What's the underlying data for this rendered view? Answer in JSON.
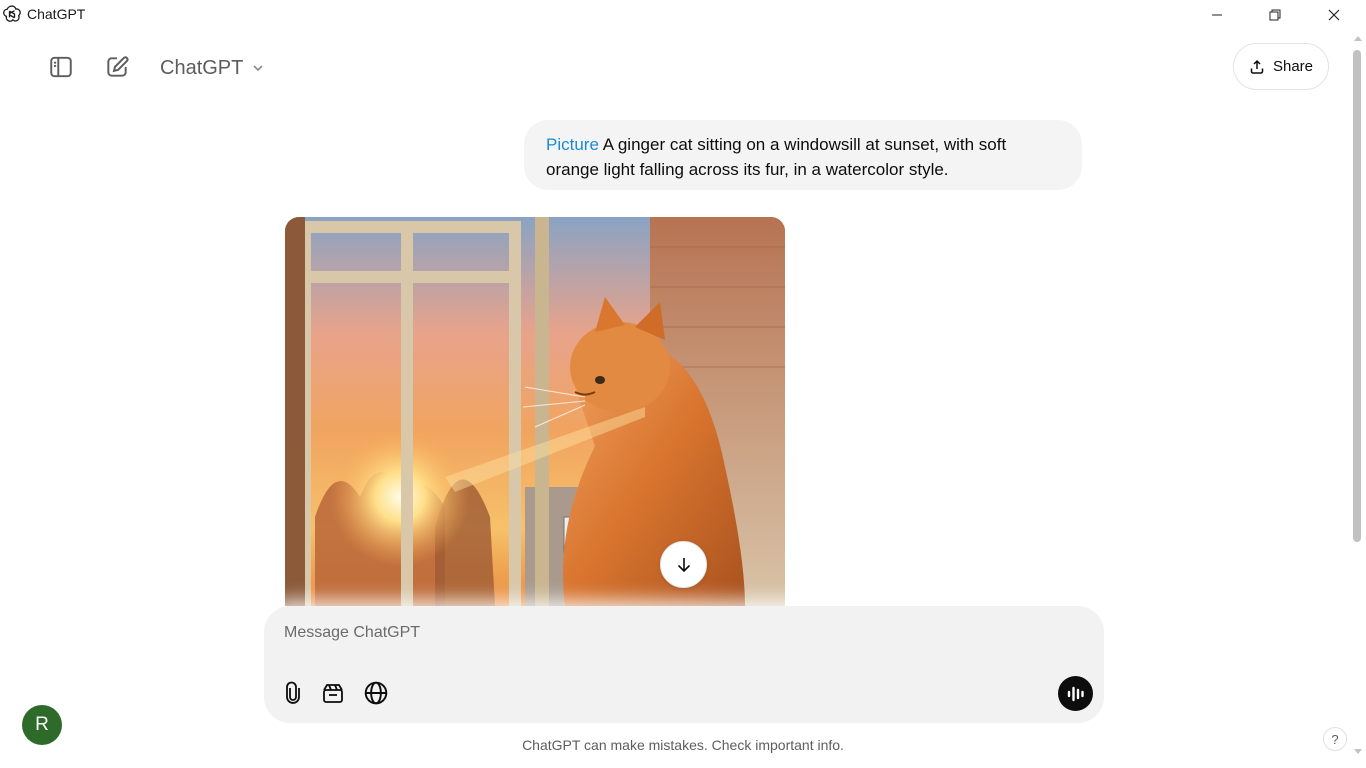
{
  "window": {
    "title": "ChatGPT",
    "logo_icon": "openai-logo-icon",
    "controls": [
      "minimize-icon",
      "restore-icon",
      "close-icon"
    ]
  },
  "header": {
    "model_name": "ChatGPT",
    "share_label": "Share",
    "icons": [
      "sidebar-toggle-icon",
      "new-chat-icon",
      "chevron-down-icon",
      "share-icon"
    ]
  },
  "conversation": {
    "user_message": {
      "tag": "Picture",
      "text": "A ginger cat sitting on a windowsill at sunset, with soft orange light falling across its fur, in a watercolor style."
    },
    "assistant_image": {
      "subject": "ginger-cat-window-sunset-watercolor"
    }
  },
  "composer": {
    "placeholder": "Message ChatGPT",
    "value": "",
    "icons": [
      "paperclip-icon",
      "tools-icon",
      "globe-icon",
      "voice-mode-icon"
    ]
  },
  "footer": {
    "disclaimer": "ChatGPT can make mistakes. Check important info.",
    "avatar_initial": "R",
    "help_label": "?"
  },
  "colors": {
    "accent_tag": "#1a8bd6",
    "avatar_bg": "#2e6b2a",
    "bubble_bg": "#f4f4f4",
    "composer_bg": "#f2f2f2",
    "voice_btn_bg": "#0d0d0d"
  }
}
